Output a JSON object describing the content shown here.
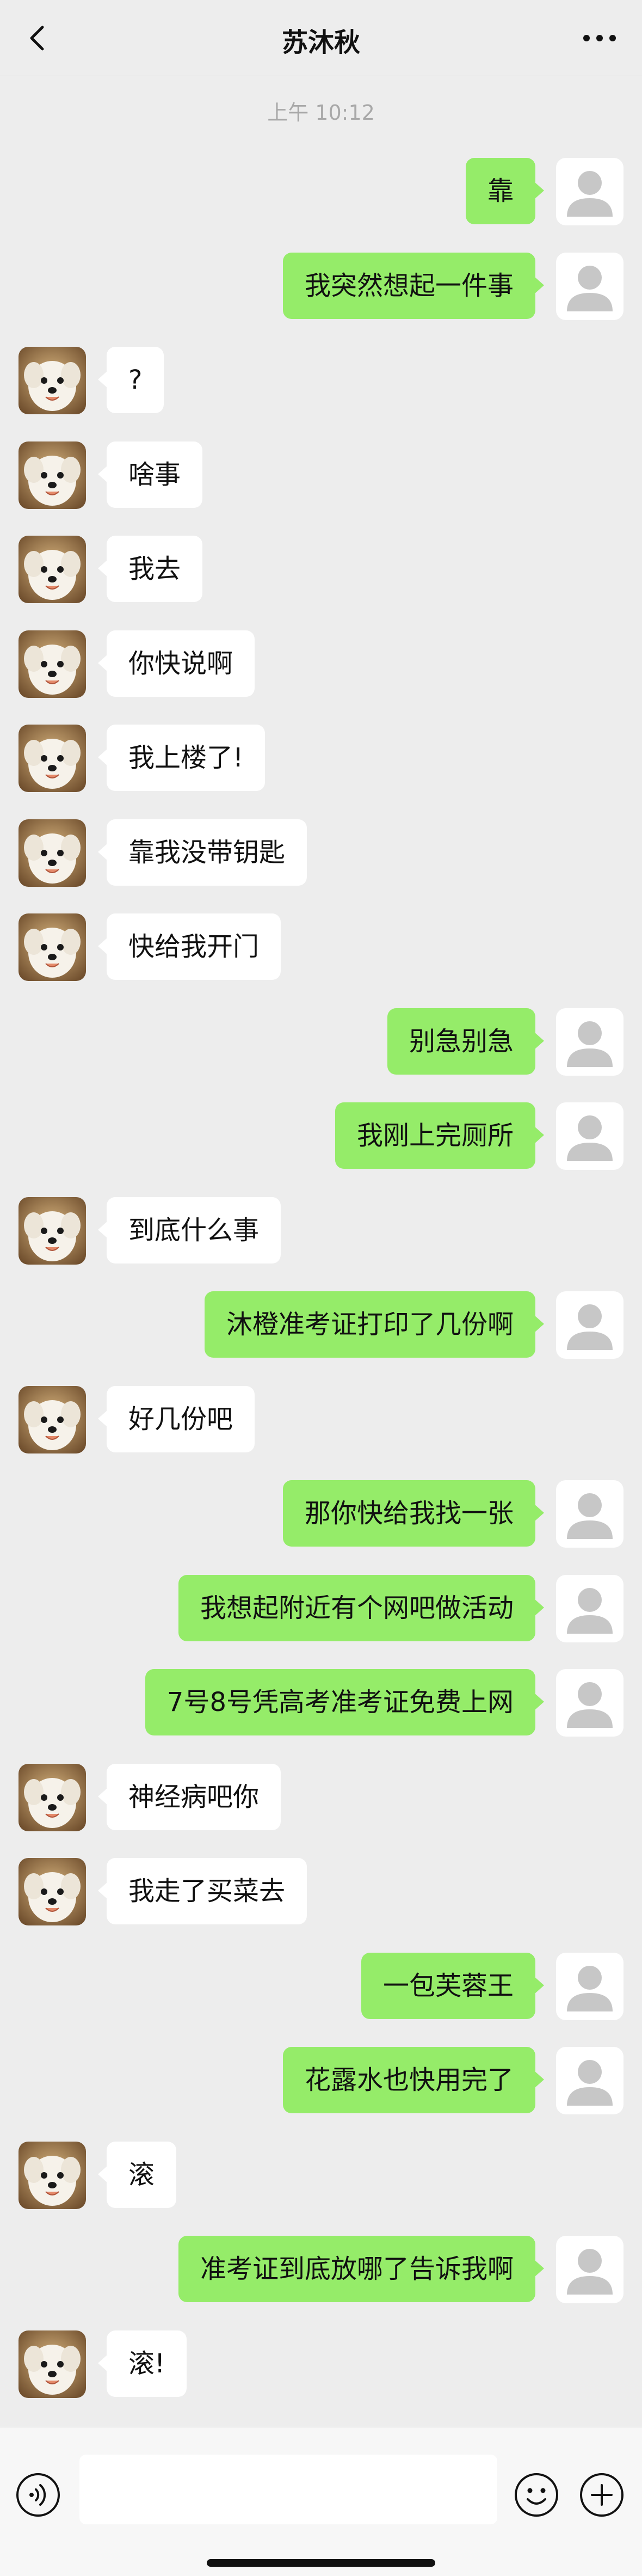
{
  "header": {
    "title": "苏沐秋",
    "back_icon": "chevron-left-icon",
    "more_icon": "more-dots-icon"
  },
  "timestamp": "上午 10:12",
  "messages": [
    {
      "side": "out",
      "text": "靠"
    },
    {
      "side": "out",
      "text": "我突然想起一件事"
    },
    {
      "side": "in",
      "text": "?"
    },
    {
      "side": "in",
      "text": "啥事"
    },
    {
      "side": "in",
      "text": "我去"
    },
    {
      "side": "in",
      "text": "你快说啊"
    },
    {
      "side": "in",
      "text": "我上楼了!"
    },
    {
      "side": "in",
      "text": "靠我没带钥匙"
    },
    {
      "side": "in",
      "text": "快给我开门"
    },
    {
      "side": "out",
      "text": "别急别急"
    },
    {
      "side": "out",
      "text": "我刚上完厕所"
    },
    {
      "side": "in",
      "text": "到底什么事"
    },
    {
      "side": "out",
      "text": "沐橙准考证打印了几份啊"
    },
    {
      "side": "in",
      "text": "好几份吧"
    },
    {
      "side": "out",
      "text": "那你快给我找一张"
    },
    {
      "side": "out",
      "text": "我想起附近有个网吧做活动"
    },
    {
      "side": "out",
      "text": "7号8号凭高考准考证免费上网"
    },
    {
      "side": "in",
      "text": "神经病吧你"
    },
    {
      "side": "in",
      "text": "我走了买菜去"
    },
    {
      "side": "out",
      "text": "一包芙蓉王"
    },
    {
      "side": "out",
      "text": "花露水也快用完了"
    },
    {
      "side": "in",
      "text": "滚"
    },
    {
      "side": "out",
      "text": "准考证到底放哪了告诉我啊"
    },
    {
      "side": "in",
      "text": "滚!"
    }
  ],
  "input_bar": {
    "placeholder": "",
    "voice_icon": "voice-icon",
    "emoji_icon": "emoji-icon",
    "plus_icon": "plus-icon"
  },
  "colors": {
    "background": "#ededed",
    "outgoing_bubble": "#95ec69",
    "incoming_bubble": "#ffffff"
  }
}
